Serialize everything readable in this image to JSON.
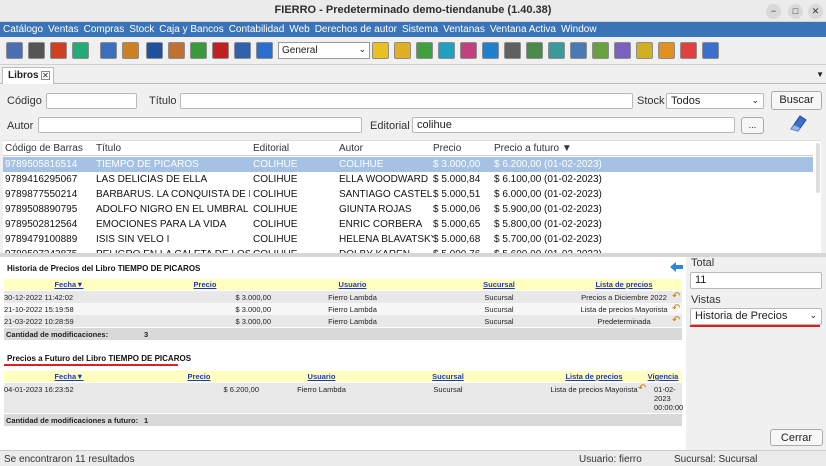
{
  "window": {
    "title": "FIERRO - Predeterminado demo-tiendanube (1.40.38)",
    "minimize": "−",
    "maximize": "□",
    "close": "✕"
  },
  "menu": [
    "Catálogo",
    "Ventas",
    "Compras",
    "Stock",
    "Caja y Bancos",
    "Contabilidad",
    "Web",
    "Derechos de autor",
    "Sistema",
    "Ventanas",
    "Ventana Activa",
    "Window"
  ],
  "toolbar": {
    "combo_value": "General",
    "icon_colors": [
      "#4a6fb5",
      "#555",
      "#d04020",
      "#2a7",
      "#3a6fc0",
      "#d08020",
      "#2050a0",
      "#c07030",
      "#3a9a3a",
      "#c02020",
      "#3060b0",
      "#2a6fd0",
      "#e8c020",
      "#e0b020",
      "#40a040",
      "#20a0c0",
      "#c04080",
      "#2080d0",
      "#606060",
      "#4a8a4a",
      "#3a9a9a",
      "#4a7ab5",
      "#6aa040",
      "#7a60c0",
      "#d0b020",
      "#e09020",
      "#e04040",
      "#3a6fd0"
    ]
  },
  "tab": {
    "label": "Libros",
    "close": "✕",
    "menu": "▼"
  },
  "search": {
    "codigo_label": "Código",
    "codigo_value": "",
    "titulo_label": "Título",
    "titulo_value": "",
    "stock_label": "Stock",
    "stock_value": "Todos",
    "buscar_label": "Buscar",
    "autor_label": "Autor",
    "autor_value": "",
    "editorial_label": "Editorial",
    "editorial_value": "colihue",
    "ellipsis_label": "..."
  },
  "grid": {
    "headers": [
      "Código de Barras",
      "Título",
      "Editorial",
      "Autor",
      "Precio",
      "Precio a futuro ▼"
    ],
    "rows": [
      [
        "9789505816514",
        "TIEMPO DE PICAROS",
        "COLIHUE",
        "COLIHUE",
        "$ 3.000,00",
        "$ 6.200,00 (01-02-2023)"
      ],
      [
        "9789416295067",
        "LAS DELICIAS DE ELLA",
        "COLIHUE",
        "ELLA WOODWARD",
        "$ 5.000,84",
        "$ 6.100,00 (01-02-2023)"
      ],
      [
        "9789877550214",
        "BARBARUS. LA CONQUISTA DE R...",
        "COLIHUE",
        "SANTIAGO CASTEL...",
        "$ 5.000,51",
        "$ 6.000,00 (01-02-2023)"
      ],
      [
        "9789508890795",
        "ADOLFO NIGRO EN EL UMBRAL D...",
        "COLIHUE",
        "GIUNTA ROJAS",
        "$ 5.000,06",
        "$ 5.900,00 (01-02-2023)"
      ],
      [
        "9789502812564",
        "EMOCIONES PARA LA VIDA",
        "COLIHUE",
        "ENRIC CORBERA",
        "$ 5.000,65",
        "$ 5.800,00 (01-02-2023)"
      ],
      [
        "9789479100889",
        "ISIS SIN VELO I",
        "COLIHUE",
        "HELENA BLAVATSKY",
        "$ 5.000,68",
        "$ 5.700,00 (01-02-2023)"
      ],
      [
        "9789507243875",
        "PELIGRO EN LA CALETA DE LOS D...",
        "COLIHUE",
        "DOLBY KAREN",
        "$ 5.000,76",
        "$ 5.600,00 (01-02-2023)"
      ]
    ]
  },
  "history": {
    "title": "Historia de Precios del Libro TIEMPO DE PICAROS",
    "headers": [
      "Fecha▼",
      "Precio",
      "Usuario",
      "Sucursal",
      "Lista de precios"
    ],
    "rows": [
      [
        "30-12-2022 11:42:02",
        "$ 3.000,00",
        "Fierro Lambda",
        "Sucursal",
        "Precios a Diciembre 2022"
      ],
      [
        "21-10-2022 15:19:58",
        "$ 3.000,00",
        "Fierro Lambda",
        "Sucursal",
        "Lista de precios Mayorista"
      ],
      [
        "21-03-2022 10:28:59",
        "$ 3.000,00",
        "Fierro Lambda",
        "Sucursal",
        "Predeterminada"
      ]
    ],
    "count_label": "Cantidad de modificaciones:",
    "count_value": "3"
  },
  "future": {
    "title": "Precios a Futuro del Libro TIEMPO DE PICAROS",
    "headers": [
      "Fecha▼",
      "Precio",
      "Usuario",
      "Sucursal",
      "Lista de precios",
      "Vigencia"
    ],
    "rows": [
      [
        "04-01-2023 16:23:52",
        "$ 6.200,00",
        "Fierro Lambda",
        "Sucursal",
        "Lista de precios Mayorista",
        "01-02-2023 00:00:00"
      ]
    ],
    "count_label": "Cantidad de modificaciones a futuro:",
    "count_value": "1"
  },
  "right": {
    "total_label": "Total",
    "total_value": "11",
    "vistas_label": "Vistas",
    "vistas_value": "Historia de Precios",
    "cerrar_label": "Cerrar"
  },
  "status": {
    "results": "Se encontraron 11 resultados",
    "user": "Usuario: fierro",
    "branch": "Sucursal: Sucursal"
  }
}
